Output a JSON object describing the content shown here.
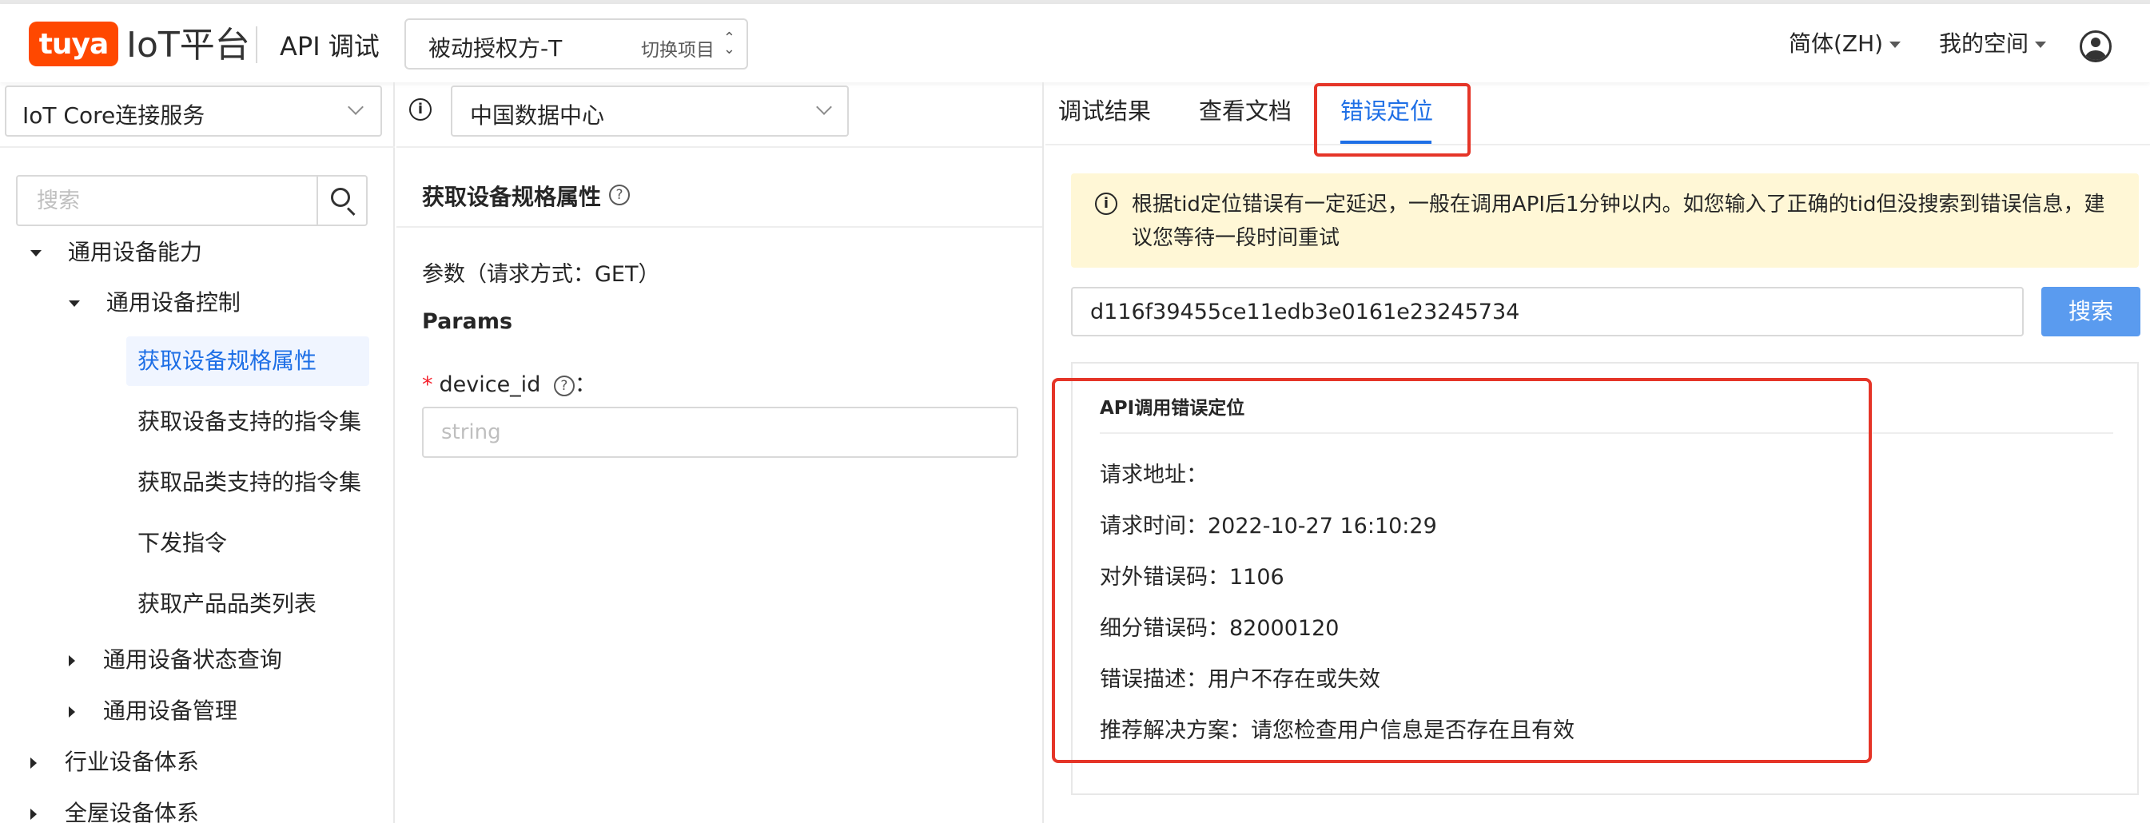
{
  "header": {
    "logo_mark": "tuya",
    "logo_text": "IoT平台",
    "title": "API 调试",
    "project": {
      "name": "被动授权方-T",
      "switch_label": "切换项目"
    },
    "language": "简体(ZH)",
    "workspace": "我的空间",
    "user_icon": "user-circle-icon"
  },
  "sidebar": {
    "service_select": "IoT Core连接服务",
    "search_placeholder": "搜索",
    "tree": [
      {
        "label": "通用设备能力",
        "expanded": true
      },
      {
        "label": "通用设备控制",
        "expanded": true
      },
      {
        "label": "获取设备规格属性",
        "active": true
      },
      {
        "label": "获取设备支持的指令集"
      },
      {
        "label": "获取品类支持的指令集"
      },
      {
        "label": "下发指令"
      },
      {
        "label": "获取产品品类列表"
      },
      {
        "label": "通用设备状态查询",
        "expanded": false
      },
      {
        "label": "通用设备管理",
        "expanded": false
      },
      {
        "label": "行业设备体系",
        "expanded": false
      },
      {
        "label": "全屋设备体系",
        "expanded": false
      }
    ]
  },
  "middle": {
    "datacenter": "中国数据中心",
    "api_title": "获取设备规格属性",
    "param_label": "参数（请求方式：GET）",
    "params_head": "Params",
    "field": {
      "required_mark": "*",
      "name": "device_id",
      "colon": "：",
      "placeholder": "string"
    }
  },
  "right": {
    "tabs": [
      "调试结果",
      "查看文档",
      "错误定位"
    ],
    "active_tab": "错误定位",
    "notice": "根据tid定位错误有一定延迟，一般在调用API后1分钟以内。如您输入了正确的tid但没搜索到错误信息，建议您等待一段时间重试",
    "tid_value": "d116f39455ce11edb3e0161e23245734",
    "search_button": "搜索",
    "result": {
      "title": "API调用错误定位",
      "rows": [
        "请求地址：",
        "请求时间：2022-10-27 16:10:29",
        "对外错误码：1106",
        "细分错误码：82000120",
        "错误描述：用户不存在或失效",
        "推荐解决方案：请您检查用户信息是否存在且有效"
      ]
    }
  },
  "colors": {
    "accent": "#1e6fe6",
    "brand": "#ff4800",
    "highlight_box": "#e53528",
    "notice_bg": "#fff7d6",
    "search_button": "#5a9bef"
  }
}
